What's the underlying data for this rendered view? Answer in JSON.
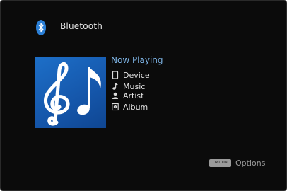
{
  "header": {
    "icon": "bluetooth-icon",
    "title": "Bluetooth"
  },
  "now_playing": {
    "heading": "Now Playing",
    "album_art": "music-notes-artwork",
    "items": [
      {
        "icon": "device-icon",
        "label": "Device"
      },
      {
        "icon": "music-note-icon",
        "label": "Music"
      },
      {
        "icon": "artist-icon",
        "label": "Artist"
      },
      {
        "icon": "album-icon",
        "label": "Album"
      }
    ]
  },
  "footer": {
    "option_button_label": "OPTION",
    "option_label": "Options"
  },
  "colors": {
    "background": "#0b0b0b",
    "accent": "#7fb6e8",
    "text": "#e2e2e2",
    "art_blue": "#1d6fc8"
  }
}
